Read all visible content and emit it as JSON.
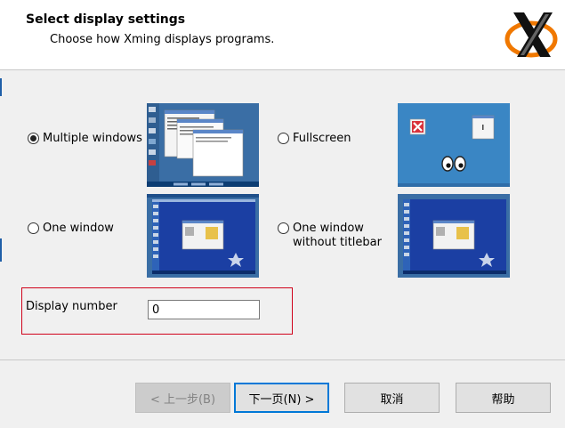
{
  "header": {
    "title": "Select display settings",
    "subtitle": "Choose how Xming displays programs."
  },
  "options": [
    {
      "label": "Multiple windows",
      "checked": true
    },
    {
      "label": "Fullscreen",
      "checked": false
    },
    {
      "label": "One window",
      "checked": false
    },
    {
      "label": "One window\nwithout titlebar",
      "checked": false
    }
  ],
  "display_number": {
    "label": "Display number",
    "value": "0"
  },
  "buttons": {
    "back": "< 上一步(B)",
    "next": "下一页(N) >",
    "cancel": "取消",
    "help": "帮助"
  },
  "icons": {
    "logo": "xming-logo",
    "thumbs": [
      "multiple-windows-preview",
      "fullscreen-preview",
      "one-window-preview",
      "one-window-no-titlebar-preview"
    ]
  },
  "colors": {
    "accent": "#0078d7",
    "highlight_border": "#d0021b",
    "desktop_blue": "#3a6ea5"
  }
}
